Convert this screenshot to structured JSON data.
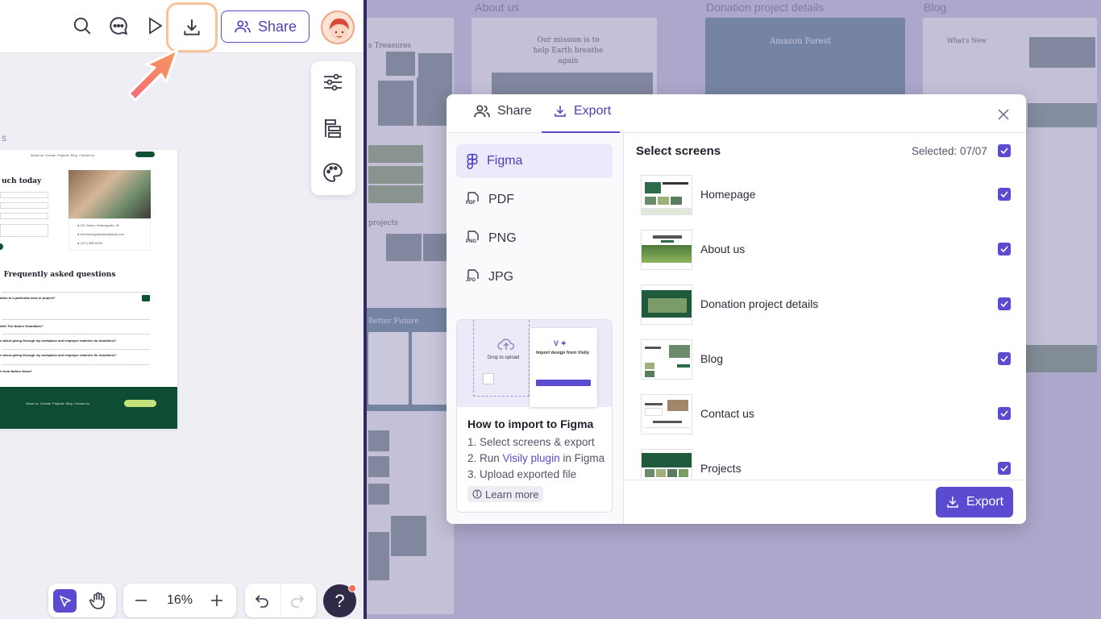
{
  "topbar": {
    "share_label": "Share",
    "icons": [
      "search-icon",
      "comment-icon",
      "play-icon",
      "download-icon"
    ]
  },
  "canvas": {
    "frame_letter": "s",
    "page_heading": "uch today",
    "faq_title": "Frequently asked questions",
    "faq_items": [
      "ation to a particular area or project?",
      "with The Nature Guardians?",
      "e about giving through my workplace and employer matches for donations?",
      "e about giving through my workplace and employer matches for donations?",
      "e from Nature News?"
    ],
    "footer_links": [
      "About us",
      "Donate",
      "Projects",
      "Blog",
      "Contact us"
    ]
  },
  "bottom": {
    "zoom": "16%"
  },
  "background": {
    "labels": [
      "About us",
      "Donation project details",
      "Blog"
    ],
    "hero_text_1": "Our mission is to help Earth breathe again",
    "hero_text_2": "Amazon Forest",
    "blog_title": "What's New",
    "section_treasures": "s Treasures",
    "section_projects": "projects",
    "section_future": "Better Future"
  },
  "modal": {
    "tab_share": "Share",
    "tab_export": "Export",
    "formats": [
      {
        "label": "Figma",
        "badge": ""
      },
      {
        "label": "PDF",
        "badge": "PDF"
      },
      {
        "label": "PNG",
        "badge": "PNG"
      },
      {
        "label": "JPG",
        "badge": "JPG"
      }
    ],
    "howto": {
      "title": "How to import to Figma",
      "step1": "1.  Select screens & export",
      "step2_pre": "2. Run ",
      "step2_link": "Visily plugin",
      "step2_post": " in Figma",
      "step3": "3. Upload exported file",
      "learn_more": "Learn more",
      "img_drop": "Drop to upload",
      "img_import": "Import design from Visily"
    },
    "select_title": "Select screens",
    "selected_count": "Selected: 07/07",
    "screens": [
      "Homepage",
      "About us",
      "Donation project details",
      "Blog",
      "Contact us",
      "Projects"
    ],
    "export_button": "Export"
  },
  "colors": {
    "accent": "#5b4bd1",
    "overlay": "#c7c5de",
    "highlight": "#f7c49a"
  }
}
